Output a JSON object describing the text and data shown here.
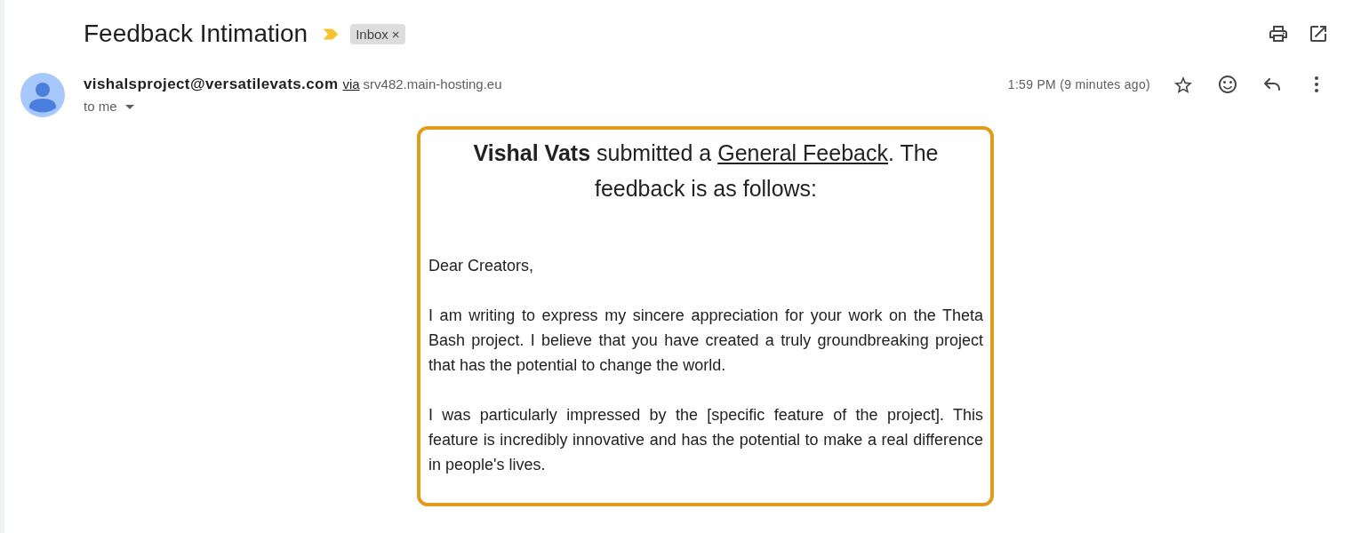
{
  "subject": {
    "title": "Feedback Intimation",
    "important": true,
    "labels": [
      {
        "name": "Inbox",
        "remove": "×"
      }
    ]
  },
  "sender": {
    "email": "vishalsproject@versatilevats.com",
    "via": "via",
    "server": "srv482.main-hosting.eu",
    "recipient": "to me",
    "time": "1:59 PM (9 minutes ago)",
    "starred": false
  },
  "message": {
    "heading": {
      "before": "**Vishal Vats** submitted a ",
      "link": "General Feeback",
      "after": ". The feedback is as follows:"
    },
    "paragraphs": [
      "Dear Creators,",
      "I am writing to express my sincere appreciation for your work on the Theta Bash project. I believe that you have created a truly groundbreaking project that has the potential to change the world.",
      "I was particularly impressed by the [specific feature of the project]. This feature is incredibly innovative and has the potential to make a real difference in people's lives."
    ]
  }
}
